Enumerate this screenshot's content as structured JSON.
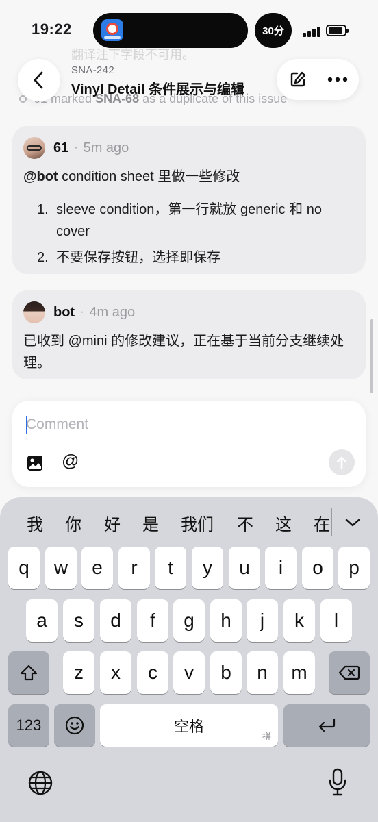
{
  "status_bar": {
    "time": "19:22",
    "timer_badge": "30分",
    "island_app_icon": "railway-app-icon"
  },
  "background": {
    "ghost_text": "翻译注下字段不可用。",
    "activity": {
      "prefix": "61 marked",
      "issue_ref": "SNA-68",
      "suffix": "as a duplicate of this issue"
    }
  },
  "header": {
    "back_icon": "chevron-left-icon",
    "issue_id": "SNA-242",
    "title": "Vinyl Detail 条件展示与编辑",
    "edit_icon": "edit-icon",
    "more_icon": "more-icon"
  },
  "comments": [
    {
      "author": "61",
      "time": "5m ago",
      "mention": "@bot",
      "text": " condition sheet 里做一些修改",
      "list": [
        {
          "num": "1.",
          "text": "sleeve condition，第一行就放 generic 和 no cover"
        },
        {
          "num": "2.",
          "text": "不要保存按钮，选择即保存"
        }
      ]
    },
    {
      "author": "bot",
      "time": "4m ago",
      "text": "已收到 @mini 的修改建议，正在基于当前分支继续处理。"
    }
  ],
  "composer": {
    "placeholder": "Comment",
    "value": "",
    "mention_label": "@",
    "image_icon": "image-icon",
    "send_icon": "arrow-up-icon"
  },
  "keyboard": {
    "candidates": [
      "我",
      "你",
      "好",
      "是",
      "我们",
      "不",
      "这",
      "在"
    ],
    "row1": [
      "q",
      "w",
      "e",
      "r",
      "t",
      "y",
      "u",
      "i",
      "o",
      "p"
    ],
    "row2": [
      "a",
      "s",
      "d",
      "f",
      "g",
      "h",
      "j",
      "k",
      "l"
    ],
    "row3": [
      "z",
      "x",
      "c",
      "v",
      "b",
      "n",
      "m"
    ],
    "numbers_label": "123",
    "space_label": "空格",
    "space_sub": "拼",
    "shift_icon": "shift-icon",
    "delete_icon": "delete-icon",
    "emoji_icon": "emoji-icon",
    "return_icon": "return-icon",
    "globe_icon": "globe-icon",
    "mic_icon": "microphone-icon"
  }
}
